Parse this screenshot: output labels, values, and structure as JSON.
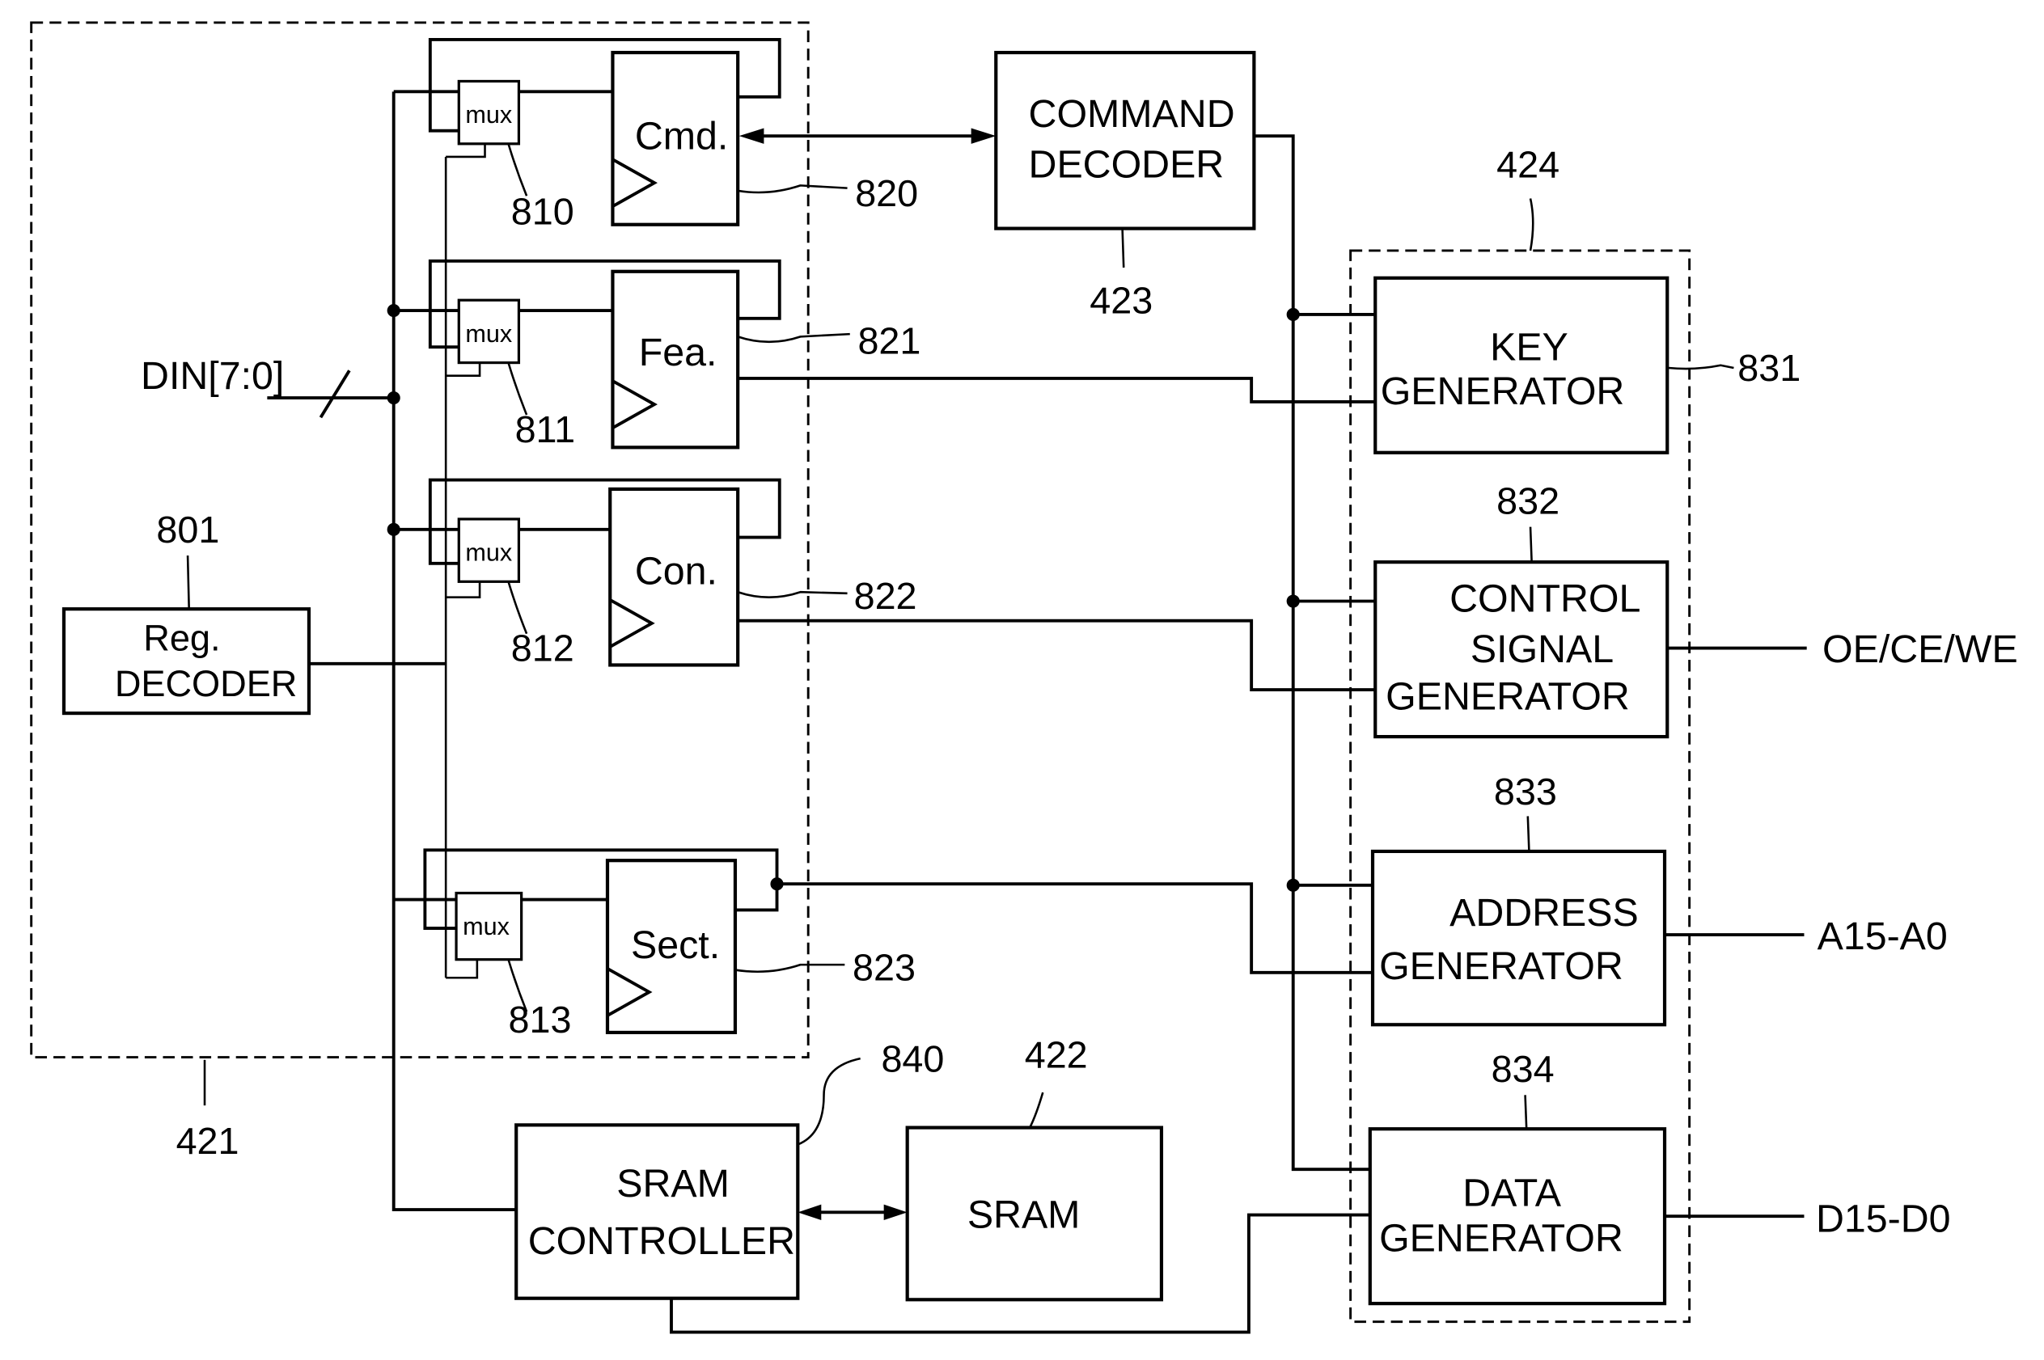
{
  "diagram": {
    "groups": {
      "g421": {
        "ref": "421"
      },
      "g424": {
        "ref": "424"
      }
    },
    "blocks": {
      "reg_decoder": {
        "line1": "Reg.",
        "line2": "DECODER",
        "ref": "801"
      },
      "cmd": {
        "label": "Cmd.",
        "ref": "820",
        "mux_ref": "810"
      },
      "fea": {
        "label": "Fea.",
        "ref": "821",
        "mux_ref": "811"
      },
      "con": {
        "label": "Con.",
        "ref": "822",
        "mux_ref": "812"
      },
      "sect": {
        "label": "Sect.",
        "ref": "823",
        "mux_ref": "813"
      },
      "command_decoder": {
        "line1": "COMMAND",
        "line2": "DECODER",
        "ref": "423"
      },
      "key_generator": {
        "line1": "KEY",
        "line2": "GENERATOR",
        "ref": "831"
      },
      "control_signal_generator": {
        "line1": "CONTROL",
        "line2": "SIGNAL",
        "line3": "GENERATOR",
        "ref": "832"
      },
      "address_generator": {
        "line1": "ADDRESS",
        "line2": "GENERATOR",
        "ref": "833"
      },
      "data_generator": {
        "line1": "DATA",
        "line2": "GENERATOR",
        "ref": "834"
      },
      "sram_controller": {
        "line1": "SRAM",
        "line2": "CONTROLLER",
        "ref": "840"
      },
      "sram": {
        "label": "SRAM",
        "ref": "422"
      }
    },
    "mux_label": "mux",
    "signals": {
      "din": "DIN[7:0]",
      "oe_ce_we": "OE/CE/WE",
      "address_bus": "A15-A0",
      "data_bus": "D15-D0"
    }
  }
}
